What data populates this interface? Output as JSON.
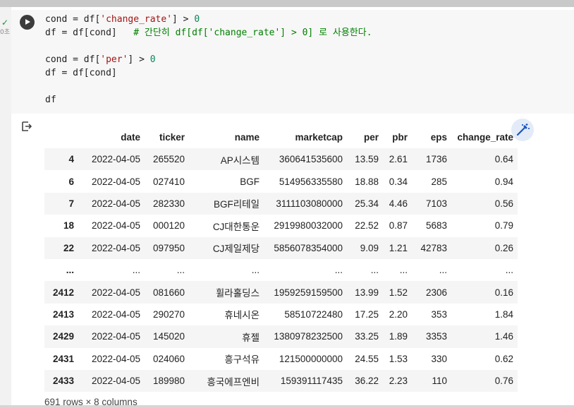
{
  "cell": {
    "status_icon": "check-icon",
    "exec_time": "0초",
    "code": [
      [
        {
          "t": "cond = df[",
          "c": ""
        },
        {
          "t": "'change_rate'",
          "c": "str"
        },
        {
          "t": "] > ",
          "c": ""
        },
        {
          "t": "0",
          "c": "num"
        }
      ],
      [
        {
          "t": "df = df[cond]   ",
          "c": ""
        },
        {
          "t": "# 간단히 df[df['change_rate'] > 0] 로 사용한다.",
          "c": "cmt"
        }
      ],
      [],
      [
        {
          "t": "cond = df[",
          "c": ""
        },
        {
          "t": "'per'",
          "c": "str"
        },
        {
          "t": "] > ",
          "c": ""
        },
        {
          "t": "0",
          "c": "num"
        }
      ],
      [
        {
          "t": "df = df[cond]",
          "c": ""
        }
      ],
      [],
      [
        {
          "t": "df",
          "c": ""
        }
      ]
    ]
  },
  "output": {
    "columns": [
      "",
      "date",
      "ticker",
      "name",
      "marketcap",
      "per",
      "pbr",
      "eps",
      "change_rate"
    ],
    "rows": [
      [
        "4",
        "2022-04-05",
        "265520",
        "AP시스템",
        "360641535600",
        "13.59",
        "2.61",
        "1736",
        "0.64"
      ],
      [
        "6",
        "2022-04-05",
        "027410",
        "BGF",
        "514956335580",
        "18.88",
        "0.34",
        "285",
        "0.94"
      ],
      [
        "7",
        "2022-04-05",
        "282330",
        "BGF리테일",
        "3111103080000",
        "25.34",
        "4.46",
        "7103",
        "0.56"
      ],
      [
        "18",
        "2022-04-05",
        "000120",
        "CJ대한통운",
        "2919980032000",
        "22.52",
        "0.87",
        "5683",
        "0.79"
      ],
      [
        "22",
        "2022-04-05",
        "097950",
        "CJ제일제당",
        "5856078354000",
        "9.09",
        "1.21",
        "42783",
        "0.26"
      ],
      [
        "...",
        "...",
        "...",
        "...",
        "...",
        "...",
        "...",
        "...",
        "..."
      ],
      [
        "2412",
        "2022-04-05",
        "081660",
        "휠라홀딩스",
        "1959259159500",
        "13.99",
        "1.52",
        "2306",
        "0.16"
      ],
      [
        "2413",
        "2022-04-05",
        "290270",
        "휴네시온",
        "58510722480",
        "17.25",
        "2.20",
        "353",
        "1.84"
      ],
      [
        "2429",
        "2022-04-05",
        "145020",
        "휴젤",
        "1380978232500",
        "33.25",
        "1.89",
        "3353",
        "1.46"
      ],
      [
        "2431",
        "2022-04-05",
        "024060",
        "흥구석유",
        "121500000000",
        "24.55",
        "1.53",
        "330",
        "0.62"
      ],
      [
        "2433",
        "2022-04-05",
        "189980",
        "흥국에프엔비",
        "159391117435",
        "36.22",
        "2.23",
        "110",
        "0.76"
      ]
    ],
    "shape_info": "691 rows × 8 columns"
  }
}
